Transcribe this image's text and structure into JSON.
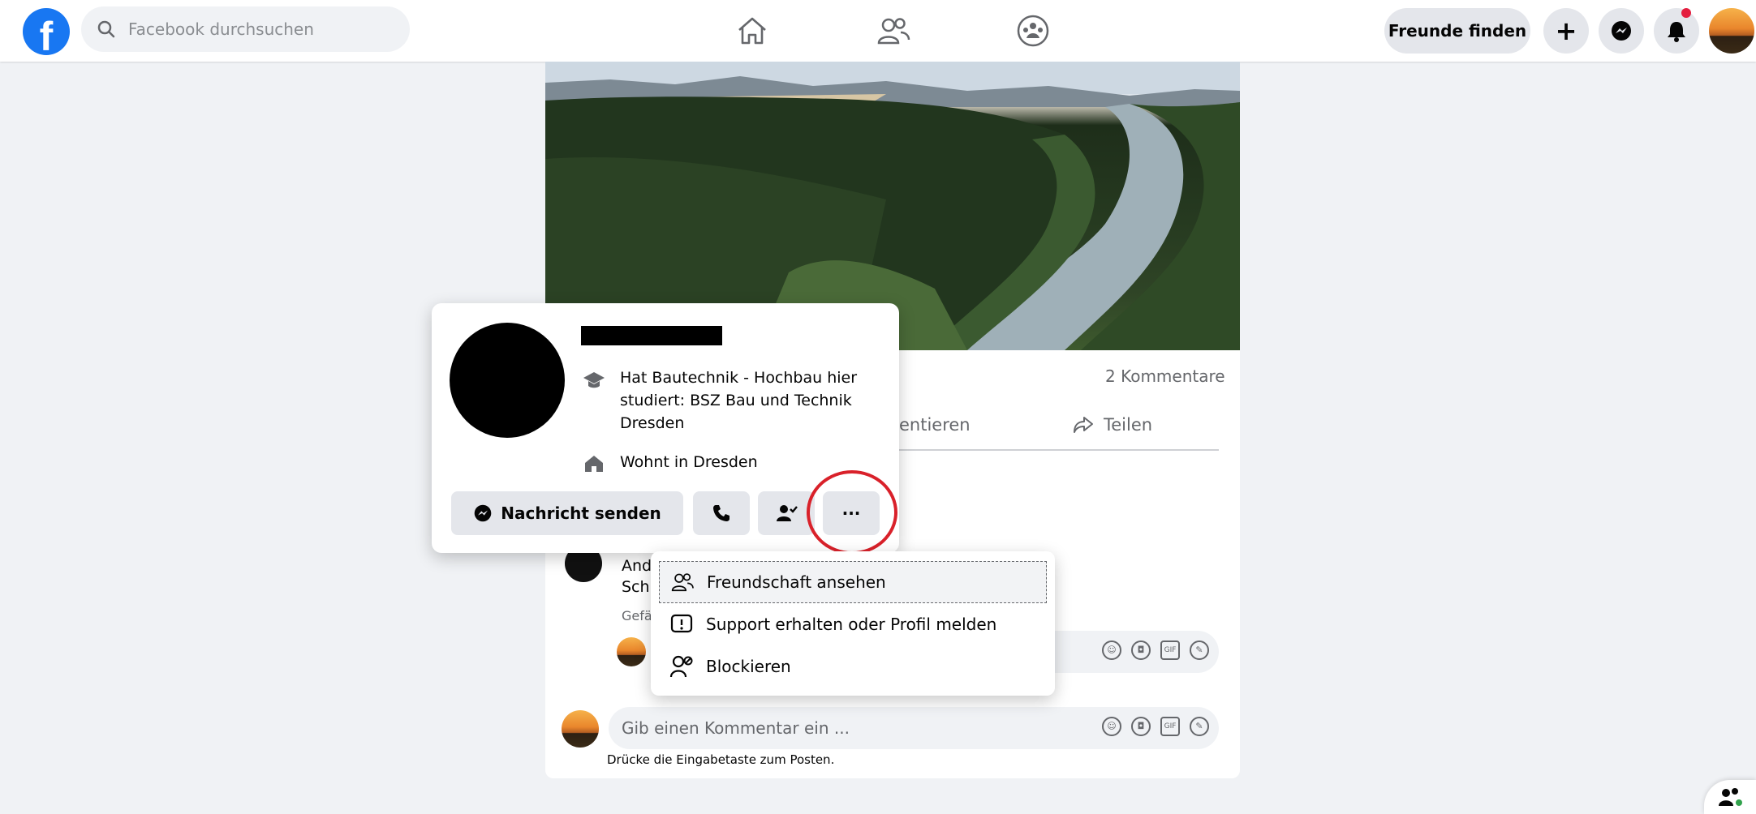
{
  "topbar": {
    "logo": "f",
    "search_placeholder": "Facebook durchsuchen",
    "find_friends": "Freunde finden",
    "plus": "+"
  },
  "post": {
    "comments_count": "2 Kommentare",
    "comment_action_partial": "entieren",
    "share": "Teilen",
    "comment_partial_line1": "And",
    "comment_partial_line2": "Sch",
    "comment_partial_meta": "Gefä",
    "comment_placeholder": "Gib einen Kommentar ein ...",
    "enter_hint": "Drücke die Eingabetaste zum Posten."
  },
  "hovercard": {
    "studied": "Hat Bautechnik - Hochbau hier studiert: BSZ Bau und Technik Dresden",
    "studied_line1": "Hat Bautechnik - Hochbau hier",
    "studied_line2": "studiert: BSZ Bau und Technik",
    "studied_line3": "Dresden",
    "lives_prefix": "Wohnt in ",
    "lives_city": "Dresden",
    "message_button": "Nachricht senden",
    "more_button": "···"
  },
  "dropdown": {
    "items": [
      {
        "label": "Freundschaft ansehen",
        "icon": "friends-icon"
      },
      {
        "label": "Support erhalten oder Profil melden",
        "icon": "report-icon"
      },
      {
        "label": "Blockieren",
        "icon": "block-user-icon"
      }
    ]
  },
  "colors": {
    "brand": "#1877f2",
    "highlight_ring": "#d9212a"
  }
}
